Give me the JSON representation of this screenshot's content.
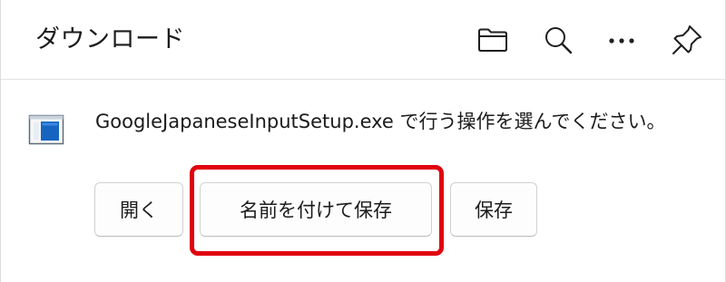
{
  "header": {
    "title": "ダウンロード",
    "icons": [
      "folder-icon",
      "search-icon",
      "more-icon",
      "pin-icon"
    ]
  },
  "item": {
    "file_icon": "installer-file-icon",
    "message": "GoogleJapaneseInputSetup.exe で行う操作を選んでください。",
    "buttons": {
      "open": "開く",
      "save_as": "名前を付けて保存",
      "save": "保存"
    }
  },
  "colors": {
    "highlight": "#e0000f",
    "file_icon_blue": "#1565c0"
  }
}
